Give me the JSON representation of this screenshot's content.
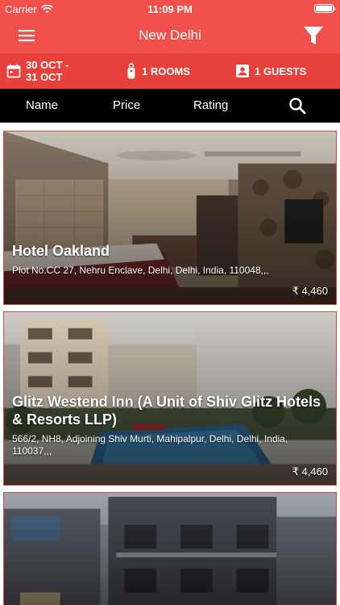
{
  "status_bar": {
    "carrier": "Carrier",
    "time": "11:09 PM"
  },
  "nav": {
    "title": "New Delhi",
    "menu_icon": "hamburger-menu-icon",
    "filter_icon": "filter-funnel-icon"
  },
  "booking": {
    "dates_line1": "30 OCT -",
    "dates_line2": "31 OCT",
    "rooms": "1 ROOMS",
    "guests": "1 GUESTS"
  },
  "sort": {
    "name": "Name",
    "price": "Price",
    "rating": "Rating",
    "search_icon": "search-icon"
  },
  "colors": {
    "brand": "#f2504b",
    "brand_dark": "#e8403b",
    "sort_bar": "#000000",
    "card_border": "#d6453f"
  },
  "hotels": [
    {
      "name": "Hotel Oakland",
      "address": "Plot No.CC 27, Nehru Enclave, Delhi, Delhi, India, 110048,,,",
      "price": "₹ 4,460"
    },
    {
      "name": "Glitz Westend Inn (A Unit of Shiv Glitz Hotels & Resorts LLP)",
      "address": "566/2, NH8, Adjoining Shiv Murti, Mahipalpur, Delhi, Delhi, India, 110037,,,",
      "price": "₹ 4,460"
    },
    {
      "name": "",
      "address": "",
      "price": ""
    }
  ]
}
